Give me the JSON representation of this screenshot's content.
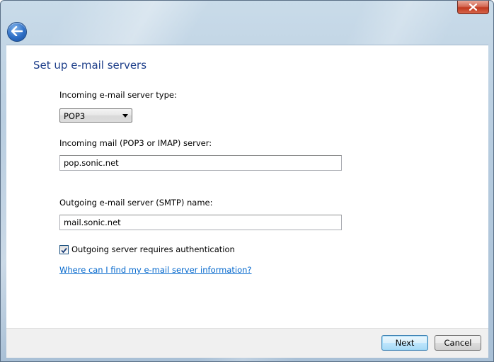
{
  "window": {
    "close_glyph": "✕"
  },
  "page": {
    "title": "Set up e-mail servers"
  },
  "form": {
    "incoming_type_label": "Incoming e-mail server type:",
    "incoming_type_value": "POP3",
    "incoming_server_label": "Incoming mail (POP3 or IMAP) server:",
    "incoming_server_value": "pop.sonic.net",
    "outgoing_server_label": "Outgoing e-mail server (SMTP) name:",
    "outgoing_server_value": "mail.sonic.net",
    "auth_checkbox_label": "Outgoing server requires authentication",
    "auth_checked": true,
    "help_link": "Where can I find my e-mail server information?"
  },
  "footer": {
    "next_label": "Next",
    "cancel_label": "Cancel"
  },
  "icons": {
    "back": "back-arrow-icon",
    "close": "close-icon",
    "dropdown": "chevron-down-icon",
    "check": "checkmark-icon"
  },
  "colors": {
    "title": "#1e3f8a",
    "link": "#0066cc",
    "close_button": "#c0391f",
    "back_button": "#2e6fc6"
  }
}
